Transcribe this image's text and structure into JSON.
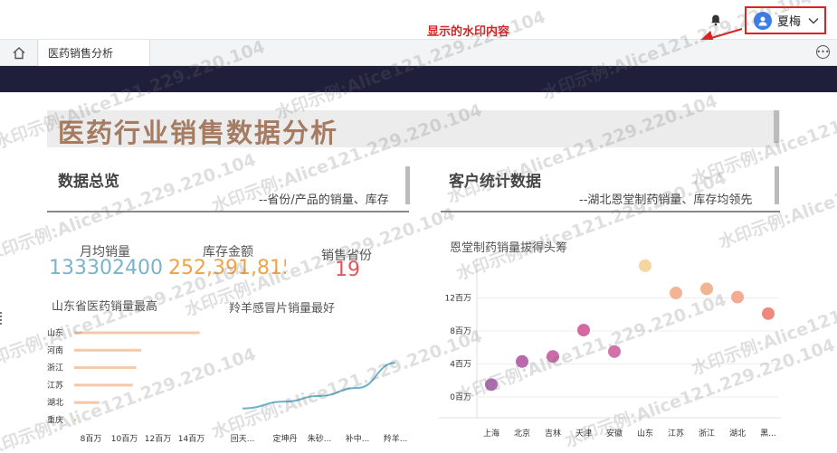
{
  "header": {
    "user_name": "夏梅",
    "watermark_callout": "显示的水印内容",
    "icons": {
      "notification": "bell-icon",
      "avatar": "user-avatar-icon",
      "dropdown": "chevron-down-icon"
    }
  },
  "tabs": [
    {
      "label": "医药销售分析"
    }
  ],
  "report": {
    "title": "医药行业销售数据分析",
    "left_section": {
      "heading": "数据总览",
      "subheading": "--省份/产品的销量、库存"
    },
    "right_section": {
      "heading": "客户统计数据",
      "subheading": "--湖北恩堂制药销量、库存均领先"
    },
    "kpis": [
      {
        "label": "月均销量",
        "value": "133302400",
        "color": "#7bb3c8"
      },
      {
        "label": "库存金额",
        "value": "252,391,815",
        "color": "#f0a247"
      },
      {
        "label": "销售省份",
        "value": "19",
        "color": "#e0565b"
      }
    ]
  },
  "watermark_text": "水印示例:Alice121.229.220.104",
  "chart_data": [
    {
      "type": "bar",
      "title": "山东省医药销量最高",
      "orientation": "horizontal",
      "categories": [
        "山东",
        "河南",
        "浙江",
        "江苏",
        "湖北",
        "重庆"
      ],
      "values": [
        14500000,
        11000000,
        10700000,
        10500000,
        8500000,
        4000000
      ],
      "x_tick_labels": [
        "8百万",
        "10百万",
        "12百万",
        "14百万"
      ],
      "xlim": [
        7000000,
        15000000
      ],
      "color": "#f6c8a8"
    },
    {
      "type": "line",
      "title": "羚羊感冒片销量最好",
      "categories": [
        "回天...",
        "定坤丹",
        "朱砂...",
        "补中...",
        "羚羊..."
      ],
      "values": [
        1,
        2.2,
        3.2,
        4.6,
        9
      ],
      "ylim": [
        0,
        10
      ],
      "color": "#6cb1c9"
    },
    {
      "type": "scatter",
      "title": "恩堂制药销量拔得头筹",
      "categories": [
        "上海",
        "北京",
        "吉林",
        "天津",
        "安徽",
        "山东",
        "江苏",
        "浙江",
        "湖北",
        "黑..."
      ],
      "values": [
        1.5,
        4.3,
        4.9,
        8.1,
        5.5,
        15.9,
        12.6,
        13.1,
        12.1,
        10.1
      ],
      "colors": [
        "#a866ac",
        "#b462a8",
        "#c864a3",
        "#d2609b",
        "#cf6aa7",
        "#f6d49a",
        "#f2b08f",
        "#f0b18c",
        "#f2a88b",
        "#ec8476"
      ],
      "y_tick_labels": [
        "0百万",
        "4百万",
        "8百万",
        "12百万"
      ],
      "ylim": [
        0,
        16
      ]
    }
  ]
}
